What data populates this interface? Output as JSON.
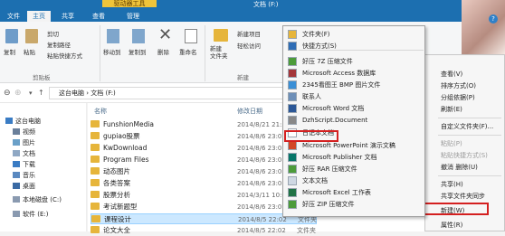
{
  "window": {
    "title": "文档 (F:)",
    "context_tab": "驱动器工具",
    "help_glyph": "?"
  },
  "tabs": [
    {
      "label": "文件"
    },
    {
      "label": "主页"
    },
    {
      "label": "共享"
    },
    {
      "label": "查看"
    },
    {
      "label": "管理"
    }
  ],
  "ribbon": {
    "copy_label": "复制",
    "paste_label": "粘贴",
    "cut_label": "剪切",
    "copy_path_label": "复制路径",
    "paste_shortcut_label": "粘贴快捷方式",
    "clipboard_group": "剪贴板",
    "move_to_label": "移动到",
    "copy_to_label": "复制到",
    "delete_label": "删除",
    "rename_label": "重命名",
    "new_folder_label": "新建\n文件夹",
    "new_item_label": "新建项目",
    "easy_access_label": "轻松访问",
    "new_group": "新建"
  },
  "address": {
    "path": "这台电脑 › 文档 (F:)"
  },
  "nav": {
    "items": [
      {
        "label": "这台电脑"
      },
      {
        "label": "视频"
      },
      {
        "label": "图片"
      },
      {
        "label": "文档"
      },
      {
        "label": "下载"
      },
      {
        "label": "音乐"
      },
      {
        "label": "桌面"
      },
      {
        "label": "本地磁盘 (C:)"
      },
      {
        "label": "软件 (E:)"
      }
    ]
  },
  "files": {
    "col_name": "名称",
    "col_date": "修改日期",
    "rows": [
      {
        "name": "FunshionMedia",
        "date": "2014/8/21 21:5",
        "type": ""
      },
      {
        "name": "gupiao股票",
        "date": "2014/8/6 23:0",
        "type": ""
      },
      {
        "name": "KwDownload",
        "date": "2014/8/6 23:0",
        "type": ""
      },
      {
        "name": "Program Files",
        "date": "2014/8/6 23:0",
        "type": ""
      },
      {
        "name": "动态图片",
        "date": "2014/8/6 23:0",
        "type": ""
      },
      {
        "name": "各类答案",
        "date": "2014/8/6 23:0",
        "type": ""
      },
      {
        "name": "股票分析",
        "date": "2014/3/11 10:0",
        "type": ""
      },
      {
        "name": "考试新题型",
        "date": "2014/8/6 23:0",
        "type": ""
      },
      {
        "name": "课程设计",
        "date": "2014/8/5 22:02",
        "type": "文件夹"
      },
      {
        "name": "论文大全",
        "date": "2014/8/5 22:02",
        "type": "文件夹"
      }
    ]
  },
  "new_menu": {
    "items": [
      {
        "label": "文件夹(F)",
        "color": "#e6b53b"
      },
      {
        "label": "快捷方式(S)",
        "color": "#2f6db5"
      },
      {
        "label": "好压 7Z 压缩文件",
        "color": "#4c9b3a"
      },
      {
        "label": "Microsoft Access 数据库",
        "color": "#a4373a"
      },
      {
        "label": "2345看图王 BMP 图片文件",
        "color": "#3a8fd6"
      },
      {
        "label": "联系人",
        "color": "#6d8fb8"
      },
      {
        "label": "Microsoft Word 文档",
        "color": "#2b5797"
      },
      {
        "label": "DzhScript.Document",
        "color": "#888888"
      },
      {
        "label": "日记本文档",
        "color": "#ffffff"
      },
      {
        "label": "Microsoft PowerPoint 演示文稿",
        "color": "#d24726"
      },
      {
        "label": "Microsoft Publisher 文档",
        "color": "#077568"
      },
      {
        "label": "好压 RAR 压缩文件",
        "color": "#4c9b3a"
      },
      {
        "label": "文本文档",
        "color": "#cfd8e3"
      },
      {
        "label": "Microsoft Excel 工作表",
        "color": "#217346"
      },
      {
        "label": "好压 ZIP 压缩文件",
        "color": "#4c9b3a"
      }
    ]
  },
  "context_menu": {
    "items": [
      {
        "label": "查看(V)",
        "dim": false
      },
      {
        "label": "排序方式(O)",
        "dim": false
      },
      {
        "label": "分组依据(P)",
        "dim": false
      },
      {
        "label": "刷新(E)",
        "dim": false
      },
      {
        "label": "自定义文件夹(F)...",
        "dim": false
      },
      {
        "label": "粘贴(P)",
        "dim": true
      },
      {
        "label": "粘贴快捷方式(S)",
        "dim": true
      },
      {
        "label": "撤消 删除(U)",
        "dim": false
      },
      {
        "label": "共享(H)",
        "dim": false
      },
      {
        "label": "共享文件夹同步",
        "dim": false
      },
      {
        "label": "新建(W)",
        "dim": false
      },
      {
        "label": "属性(R)",
        "dim": false
      }
    ]
  }
}
